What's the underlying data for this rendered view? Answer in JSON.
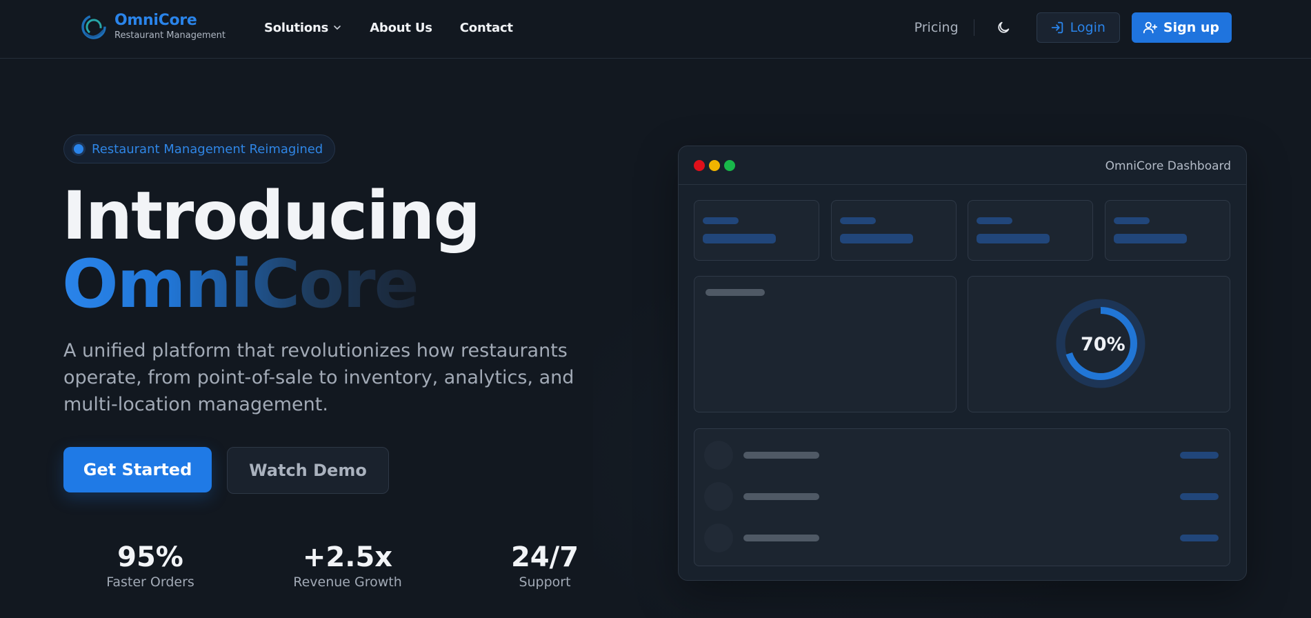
{
  "brand": {
    "name": "OmniCore",
    "tagline": "Restaurant Management",
    "color": "#2a84ea"
  },
  "nav": {
    "links": [
      {
        "label": "Solutions",
        "has_dropdown": true
      },
      {
        "label": "About Us"
      },
      {
        "label": "Contact"
      }
    ],
    "pricing": "Pricing",
    "theme_toggle_icon": "moon-icon",
    "login": "Login",
    "signup": "Sign up"
  },
  "hero": {
    "badge": "Restaurant Management Reimagined",
    "title_line1": "Introducing",
    "title_line2": "OmniCore",
    "description": "A unified platform that revolutionizes how restaurants operate, from point-of-sale to inventory, analytics, and multi-location management.",
    "primary_cta": "Get Started",
    "secondary_cta": "Watch Demo",
    "stats": [
      {
        "value": "95%",
        "label": "Faster Orders"
      },
      {
        "value": "+2.5x",
        "label": "Revenue Growth"
      },
      {
        "value": "24/7",
        "label": "Support"
      }
    ]
  },
  "dashboard": {
    "title": "OmniCore Dashboard",
    "window_dots": [
      "#e0101a",
      "#f0b400",
      "#18b84a"
    ],
    "progress_label": "70%",
    "progress_value": 0.7
  },
  "colors": {
    "background": "#121820",
    "accent": "#1f7ae6",
    "muted_text": "#a2aab6"
  }
}
